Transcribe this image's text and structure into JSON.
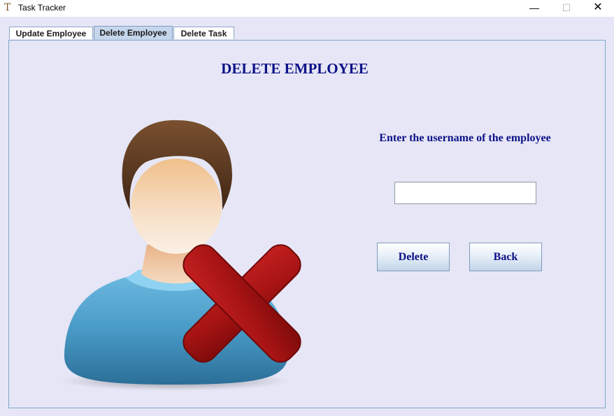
{
  "window": {
    "title": "Task Tracker",
    "icon": "T",
    "minimize": "—",
    "maximize": "☐",
    "close": "✕"
  },
  "tabs": [
    {
      "label": "Update Employee",
      "active": false
    },
    {
      "label": "Delete Employee",
      "active": true
    },
    {
      "label": "Delete Task",
      "active": false
    }
  ],
  "main": {
    "heading": "DELETE EMPLOYEE",
    "prompt": "Enter the username of the employee",
    "username_value": "",
    "delete_label": "Delete",
    "back_label": "Back"
  },
  "illustration": {
    "icon": "user-delete-icon"
  },
  "colors": {
    "background": "#e6e6f6",
    "heading_text": "#0b1187",
    "tab_active": "#c5d6ec",
    "cross_red": "#a81414",
    "shirt_blue": "#4a9cc8",
    "hair_brown": "#5a3a22"
  }
}
